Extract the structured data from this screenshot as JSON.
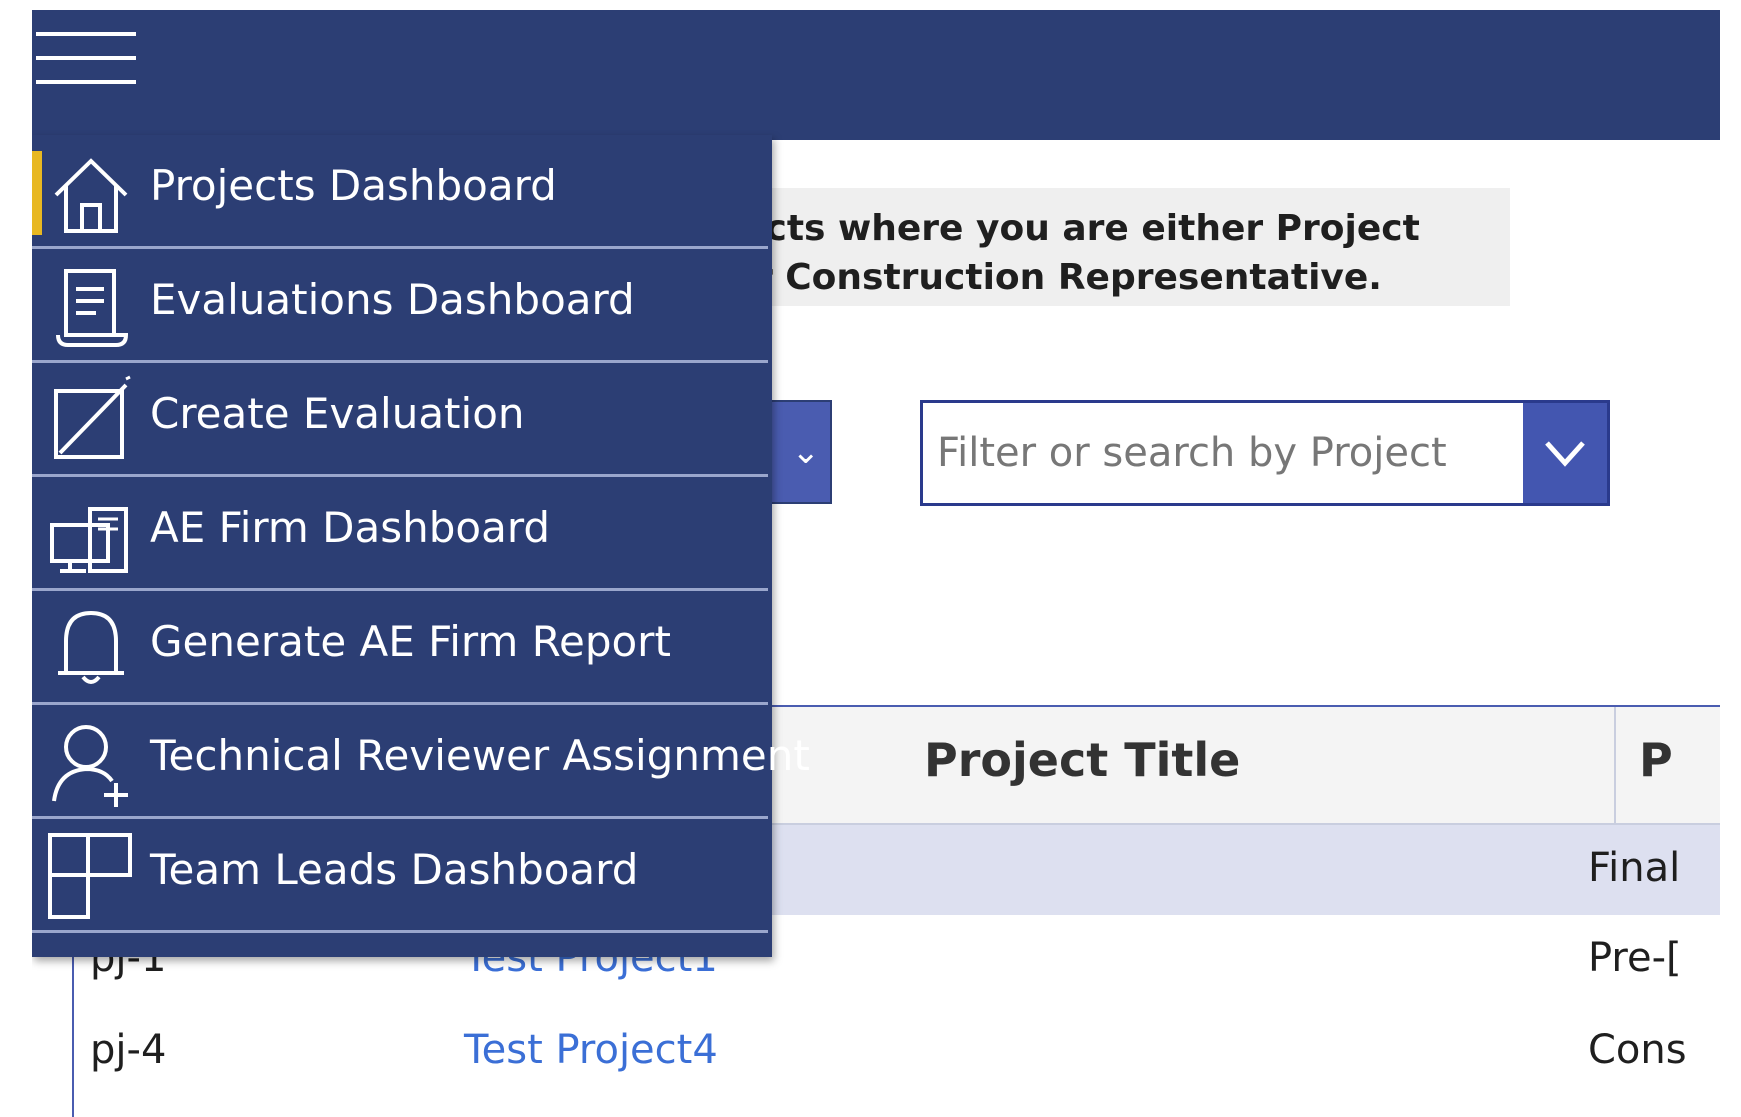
{
  "banner": {
    "text": "ojects where you are either Project\n, or Construction Representative."
  },
  "filter": {
    "placeholder": "Filter or search by Project",
    "value": ""
  },
  "grid": {
    "columns": [
      {
        "label": "Project Title"
      },
      {
        "label": "P"
      }
    ],
    "rows": [
      {
        "id": "",
        "title": "",
        "phase": "Final",
        "selected": true
      },
      {
        "id": "pj-1",
        "title": "Test Project1",
        "phase": "Pre-["
      },
      {
        "id": "pj-4",
        "title": "Test Project4",
        "phase": "Cons"
      }
    ]
  },
  "nav": {
    "items": [
      {
        "label": "Projects Dashboard",
        "icon": "home-icon",
        "active": true
      },
      {
        "label": "Evaluations Dashboard",
        "icon": "document-icon"
      },
      {
        "label": "Create Evaluation",
        "icon": "edit-icon"
      },
      {
        "label": "AE Firm Dashboard",
        "icon": "devices-icon"
      },
      {
        "label": "Generate AE Firm Report",
        "icon": "bell-icon"
      },
      {
        "label": "Technical Reviewer Assignment",
        "icon": "add-person-icon"
      },
      {
        "label": "Team Leads Dashboard",
        "icon": "grid-icon"
      }
    ]
  },
  "colors": {
    "header": "#2c3e74",
    "accent": "#e8b822",
    "link": "#3b6fd6",
    "selected_row": "#dde0f0"
  }
}
